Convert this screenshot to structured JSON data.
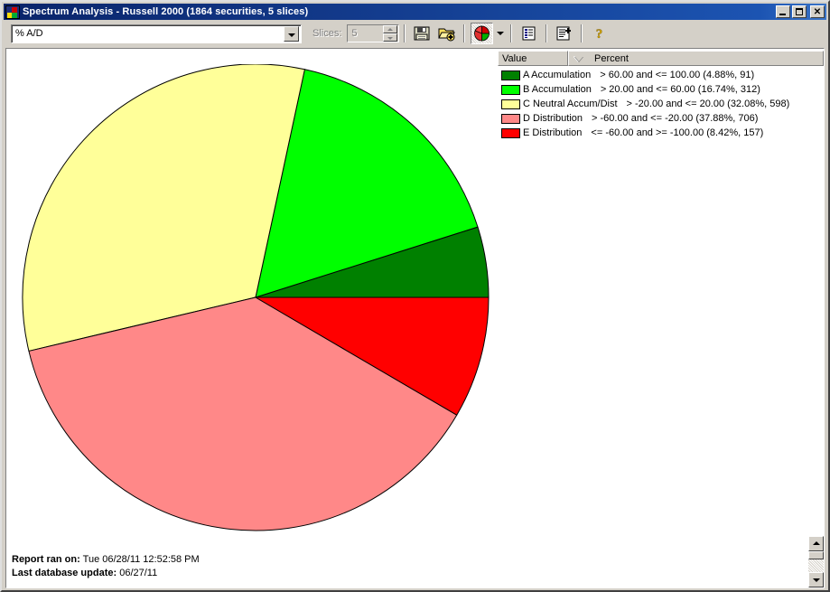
{
  "window": {
    "title": "Spectrum Analysis - Russell 2000 (1864 securities, 5 slices)",
    "icon": "pie-chart-icon",
    "minimize_label": "",
    "maximize_label": "",
    "close_label": "✕"
  },
  "toolbar": {
    "metric_select_value": "% A/D",
    "slices_label": "Slices:",
    "slices_value": "5",
    "buttons": [
      {
        "name": "save-button",
        "icon": "floppy-disk-icon"
      },
      {
        "name": "open-add-button",
        "icon": "folder-add-icon"
      },
      {
        "name": "pie-chart-view-button",
        "icon": "pie-chart-icon"
      },
      {
        "name": "chart-type-dropdown-button",
        "icon": "chevron-down-icon"
      },
      {
        "name": "report-list-button",
        "icon": "report-list-icon"
      },
      {
        "name": "report-add-button",
        "icon": "report-add-icon"
      },
      {
        "name": "help-button",
        "icon": "question-mark-icon"
      }
    ]
  },
  "legend": {
    "columns": [
      "Value",
      "Percent"
    ],
    "sort_indicator": "descending",
    "rows": [
      {
        "label": "A Accumulation",
        "desc": "> 60.00 and <= 100.00 (4.88%, 91)",
        "color": "#008000"
      },
      {
        "label": "B Accumulation",
        "desc": "> 20.00 and <= 60.00 (16.74%, 312)",
        "color": "#00ff00"
      },
      {
        "label": "C Neutral Accum/Dist",
        "desc": "> -20.00 and <= 20.00 (32.08%, 598)",
        "color": "#ffff99"
      },
      {
        "label": "D Distribution",
        "desc": "> -60.00 and <= -20.00 (37.88%, 706)",
        "color": "#ff8888"
      },
      {
        "label": "E Distribution",
        "desc": "<= -60.00 and >= -100.00 (8.42%, 157)",
        "color": "#ff0000"
      }
    ]
  },
  "footer": {
    "ran_on_label": "Report ran on:",
    "ran_on_value": "Tue 06/28/11 12:52:58 PM",
    "updated_label": "Last database update:",
    "updated_value": "06/27/11"
  },
  "chart_data": {
    "type": "pie",
    "title": "Spectrum Analysis - Russell 2000",
    "total_securities": 1864,
    "slice_count": 5,
    "start_angle_deg": 0,
    "direction": "counterclockwise",
    "center": [
      260,
      258
    ],
    "radius": 258,
    "categories": [
      "A Accumulation",
      "B Accumulation",
      "C Neutral Accum/Dist",
      "D Distribution",
      "E Distribution"
    ],
    "values": [
      4.88,
      16.74,
      32.08,
      37.88,
      8.42
    ],
    "counts": [
      91,
      312,
      598,
      706,
      157
    ],
    "colors": [
      "#008000",
      "#00ff00",
      "#ffff99",
      "#ff8888",
      "#ff0000"
    ],
    "ranges": [
      "> 60.00 and <= 100.00",
      "> 20.00 and <= 60.00",
      "> -20.00 and <= 20.00",
      "> -60.00 and <= -20.00",
      "<= -60.00 and >= -100.00"
    ],
    "ylabel": "",
    "xlabel": "",
    "legend_position": "right",
    "grid": false
  }
}
